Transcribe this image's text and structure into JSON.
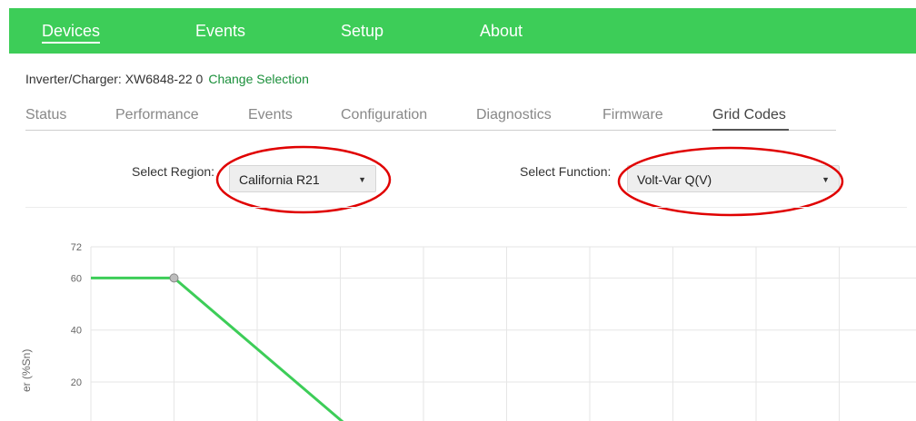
{
  "nav": {
    "items": [
      "Devices",
      "Events",
      "Setup",
      "About"
    ],
    "active": "Devices"
  },
  "device": {
    "label": "Inverter/Charger: XW6848-22 0",
    "change_link": "Change Selection"
  },
  "subtabs": {
    "items": [
      "Status",
      "Performance",
      "Events",
      "Configuration",
      "Diagnostics",
      "Firmware",
      "Grid Codes"
    ],
    "active": "Grid Codes"
  },
  "controls": {
    "region_label": "Select Region:",
    "region_value": "California R21",
    "function_label": "Select Function:",
    "function_value": "Volt-Var Q(V)"
  },
  "colors": {
    "nav_bg": "#3dcd58",
    "link": "#1a8f3a",
    "line": "#3dcd58",
    "annotation": "#e00000"
  },
  "chart_data": {
    "type": "line",
    "ylabel": "er (%Sn)",
    "y_ticks": [
      20,
      40,
      60,
      72
    ],
    "ylim": [
      20,
      72
    ],
    "grid": true,
    "series": [
      {
        "points": [
          [
            0,
            60
          ],
          [
            1,
            60
          ],
          [
            3.2,
            0
          ]
        ],
        "marker_index": 1
      }
    ]
  }
}
